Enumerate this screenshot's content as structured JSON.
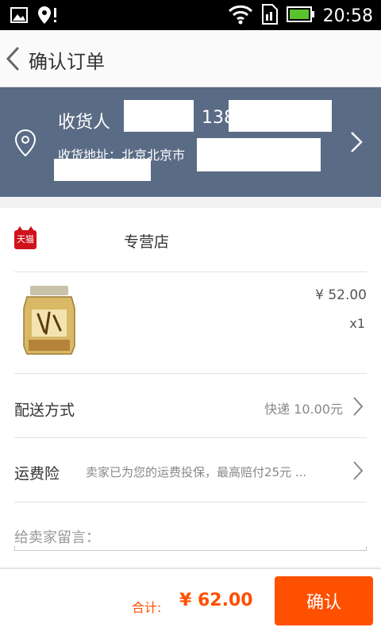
{
  "status_bar": {
    "time": "20:58"
  },
  "header": {
    "title": "确认订单"
  },
  "address": {
    "receiver_label": "收货人",
    "phone_prefix": "138",
    "address_label": "收货地址：北京北京市"
  },
  "shop": {
    "name": "专营店",
    "platform_logo_text": "天猫"
  },
  "product": {
    "price": "¥ 52.00",
    "quantity": "x1"
  },
  "delivery": {
    "label": "配送方式",
    "value": "快递 10.00元"
  },
  "insurance": {
    "label": "运费险",
    "value": "卖家已为您的运费投保，最高赔付25元 ..."
  },
  "message": {
    "placeholder": "给卖家留言："
  },
  "footer": {
    "total_label": "合计:",
    "total_value": "¥ 62.00",
    "confirm_label": "确认"
  },
  "colors": {
    "accent": "#ff5000",
    "address_bg": "#5a6b85",
    "tmall_red": "#d0121b"
  }
}
